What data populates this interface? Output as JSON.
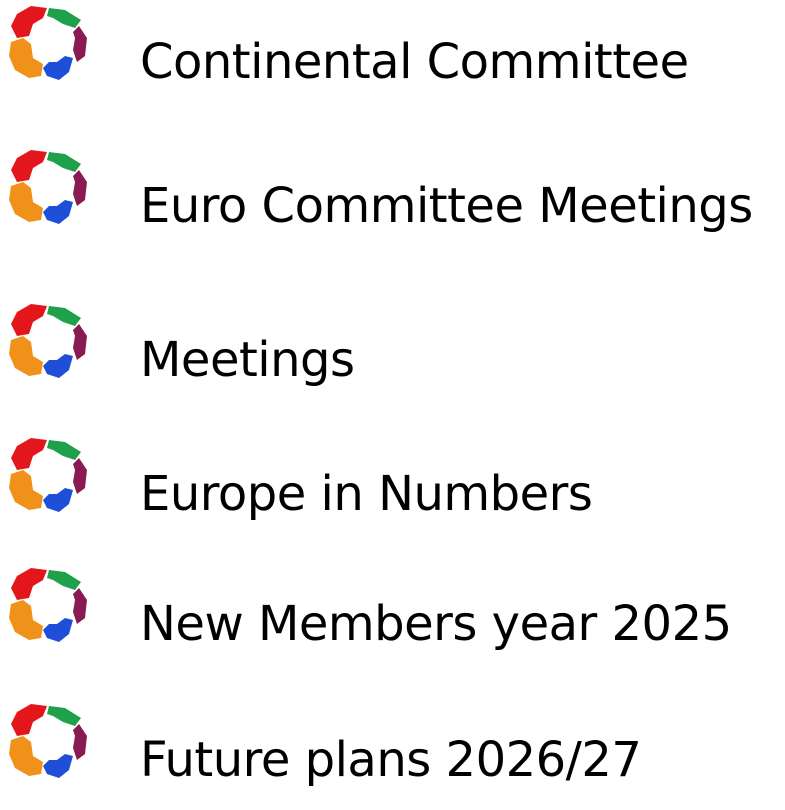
{
  "logo_icon": "continental-ring-logo-icon",
  "colors": {
    "red": "#e3161b",
    "green": "#1ea14a",
    "purple": "#8a1a52",
    "blue": "#1f4fd8",
    "orange": "#f0921a"
  },
  "menu": {
    "items": [
      {
        "label": "Continental Committee"
      },
      {
        "label": "Euro Committee Meetings"
      },
      {
        "label": "Meetings"
      },
      {
        "label": "Europe in Numbers"
      },
      {
        "label": "New Members year 2025"
      },
      {
        "label": "Future plans 2026/27"
      }
    ]
  }
}
